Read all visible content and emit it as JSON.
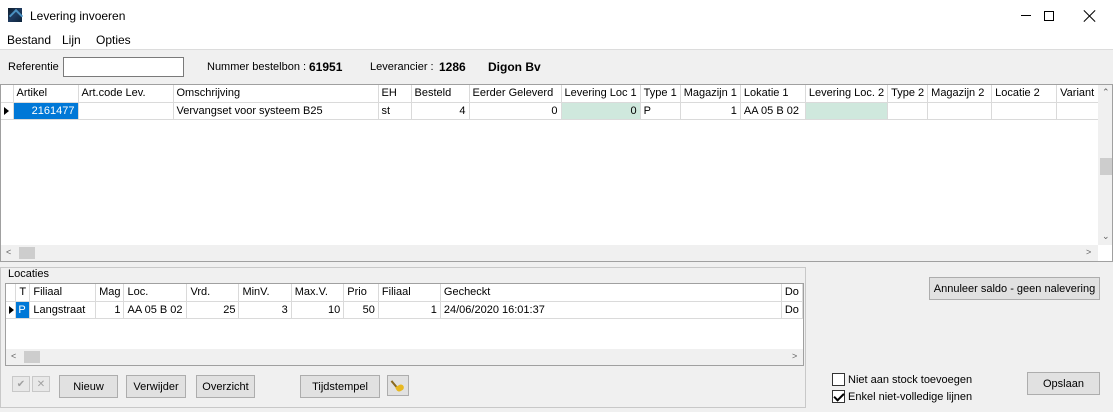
{
  "window": {
    "title": "Levering invoeren"
  },
  "menu": {
    "items": [
      "Bestand",
      "Lijn",
      "Opties"
    ]
  },
  "header": {
    "referentie_label": "Referentie",
    "referentie_value": "",
    "bestelbon_label": "Nummer bestelbon :",
    "bestelbon_value": "61951",
    "leverancier_label": "Leverancier :",
    "leverancier_code": "1286",
    "leverancier_name": "Digon Bv"
  },
  "main_grid": {
    "columns": [
      "Artikel",
      "Art.code Lev.",
      "Omschrijving",
      "EH",
      "Besteld",
      "Eerder Geleverd",
      "Levering Loc 1",
      "Type 1",
      "Magazijn 1",
      "Lokatie 1",
      "Levering Loc. 2",
      "Type 2",
      "Magazijn 2",
      "Locatie 2",
      "Variant"
    ],
    "rows": [
      [
        "2161477",
        "",
        "Vervangset voor systeem B25",
        "st",
        "4",
        "0",
        "0",
        "P",
        "1",
        "AA 05 B 02",
        "",
        "",
        "",
        "",
        ""
      ]
    ]
  },
  "locaties": {
    "group_label": "Locaties",
    "columns": [
      "T",
      "Filiaal",
      "Mag",
      "Loc.",
      "Vrd.",
      "MinV.",
      "Max.V.",
      "Prio",
      "Filiaal",
      "Gecheckt",
      "Do"
    ],
    "rows": [
      [
        "P",
        "Langstraat",
        "1",
        "AA 05 B 02",
        "25",
        "3",
        "10",
        "50",
        "1",
        "24/06/2020 16:01:37",
        "Do"
      ]
    ]
  },
  "buttons": {
    "confirm_icon": "✔",
    "cancel_icon": "✕",
    "nieuw": "Nieuw",
    "verwijder": "Verwijder",
    "overzicht": "Overzicht",
    "tijdstempel": "Tijdstempel",
    "annuleer": "Annuleer saldo - geen nalevering",
    "opslaan": "Opslaan"
  },
  "options": {
    "niet_aan_stock": {
      "label": "Niet aan stock toevoegen",
      "checked": false
    },
    "enkel_niet_volledige": {
      "label": "Enkel niet-volledige lijnen",
      "checked": true
    }
  },
  "colors": {
    "selection": "#0078d7",
    "highlight": "#cfe8dd"
  },
  "icons": {
    "app": "app-icon",
    "broom": "broom-icon"
  }
}
